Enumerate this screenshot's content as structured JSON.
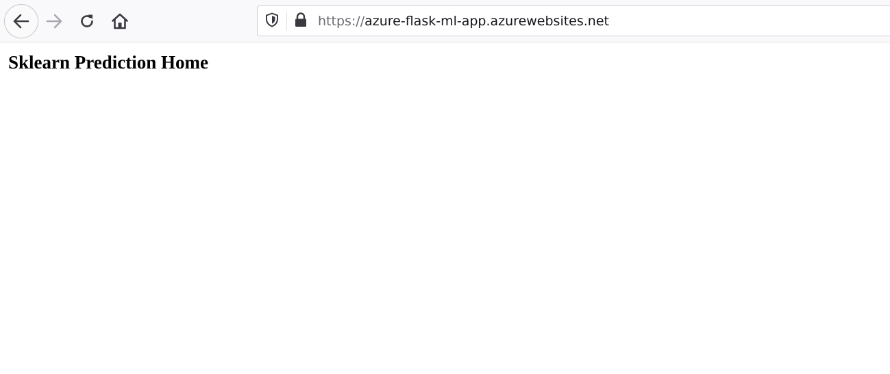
{
  "browser": {
    "navigation": {
      "back": {
        "icon": "arrow-left-icon",
        "enabled": true
      },
      "forward": {
        "icon": "arrow-right-icon",
        "enabled": false
      },
      "reload": {
        "icon": "reload-icon"
      },
      "home": {
        "icon": "home-icon"
      }
    },
    "urlbar": {
      "tracking_protection_icon": "shield-icon",
      "security_icon": "lock-icon",
      "scheme": "https://",
      "host": "azure-flask-ml-app.azurewebsites.net"
    }
  },
  "page": {
    "heading": "Sklearn Prediction Home"
  },
  "colors": {
    "toolbar_background": "#f9f9fb",
    "icon_active": "#3a3a40",
    "icon_disabled": "#a8a8ae",
    "url_scheme": "#6b6b72",
    "url_host": "#15141a",
    "page_background": "#ffffff",
    "heading_text": "#000000"
  }
}
